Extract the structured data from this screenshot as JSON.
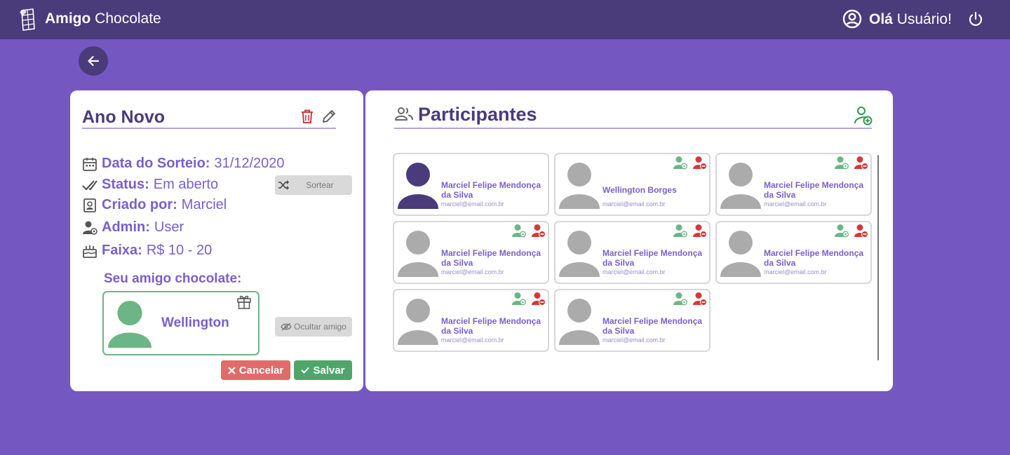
{
  "header": {
    "brand_bold": "Amigo",
    "brand_light": "Chocolate",
    "greeting_bold": "Olá",
    "greeting_light": "Usuário!"
  },
  "event": {
    "title": "Ano Novo",
    "rows": [
      {
        "label": "Data do Sorteio:",
        "value": "31/12/2020",
        "icon": "calendar-icon"
      },
      {
        "label": "Status:",
        "value": "Em aberto",
        "icon": "double-check-icon"
      },
      {
        "label": "Criado por:",
        "value": "Marciel",
        "icon": "id-card-icon"
      },
      {
        "label": "Admin:",
        "value": "User",
        "icon": "admin-user-icon"
      },
      {
        "label": "Faixa:",
        "value": "R$ 10 - 20",
        "icon": "cake-icon"
      }
    ],
    "draw_button": "Sortear",
    "friend_heading": "Seu amigo chocolate:",
    "friend_name": "Wellington",
    "hide_button": "Ocultar amigo",
    "cancel_button": "Cancelar",
    "save_button": "Salvar"
  },
  "participants": {
    "title": "Participantes",
    "list": [
      {
        "name": "Marciel Felipe Mendonça da Silva",
        "email": "marciel@email.com.br",
        "is_current_user": true
      },
      {
        "name": "Wellington Borges",
        "email": "marciel@email.com.br",
        "is_current_user": false
      },
      {
        "name": "Marciel Felipe Mendonça da Silva",
        "email": "marciel@email.com.br",
        "is_current_user": false
      },
      {
        "name": "Marciel Felipe Mendonça da Silva",
        "email": "marciel@email.com.br",
        "is_current_user": false
      },
      {
        "name": "Marciel Felipe Mendonça da Silva",
        "email": "marciel@email.com.br",
        "is_current_user": false
      },
      {
        "name": "Marciel Felipe Mendonça da Silva",
        "email": "marciel@email.com.br",
        "is_current_user": false
      },
      {
        "name": "Marciel Felipe Mendonça da Silva",
        "email": "marciel@email.com.br",
        "is_current_user": false
      },
      {
        "name": "Marciel Felipe Mendonça da Silva",
        "email": "marciel@email.com.br",
        "is_current_user": false
      }
    ]
  },
  "colors": {
    "background": "#7557c2",
    "header": "#4a3b7b",
    "accent_text": "#7a5fcb",
    "friend_green": "#6cb585",
    "cancel_red": "#e06b6b",
    "save_green": "#4ea66b",
    "avatar_gray": "#ababab"
  }
}
